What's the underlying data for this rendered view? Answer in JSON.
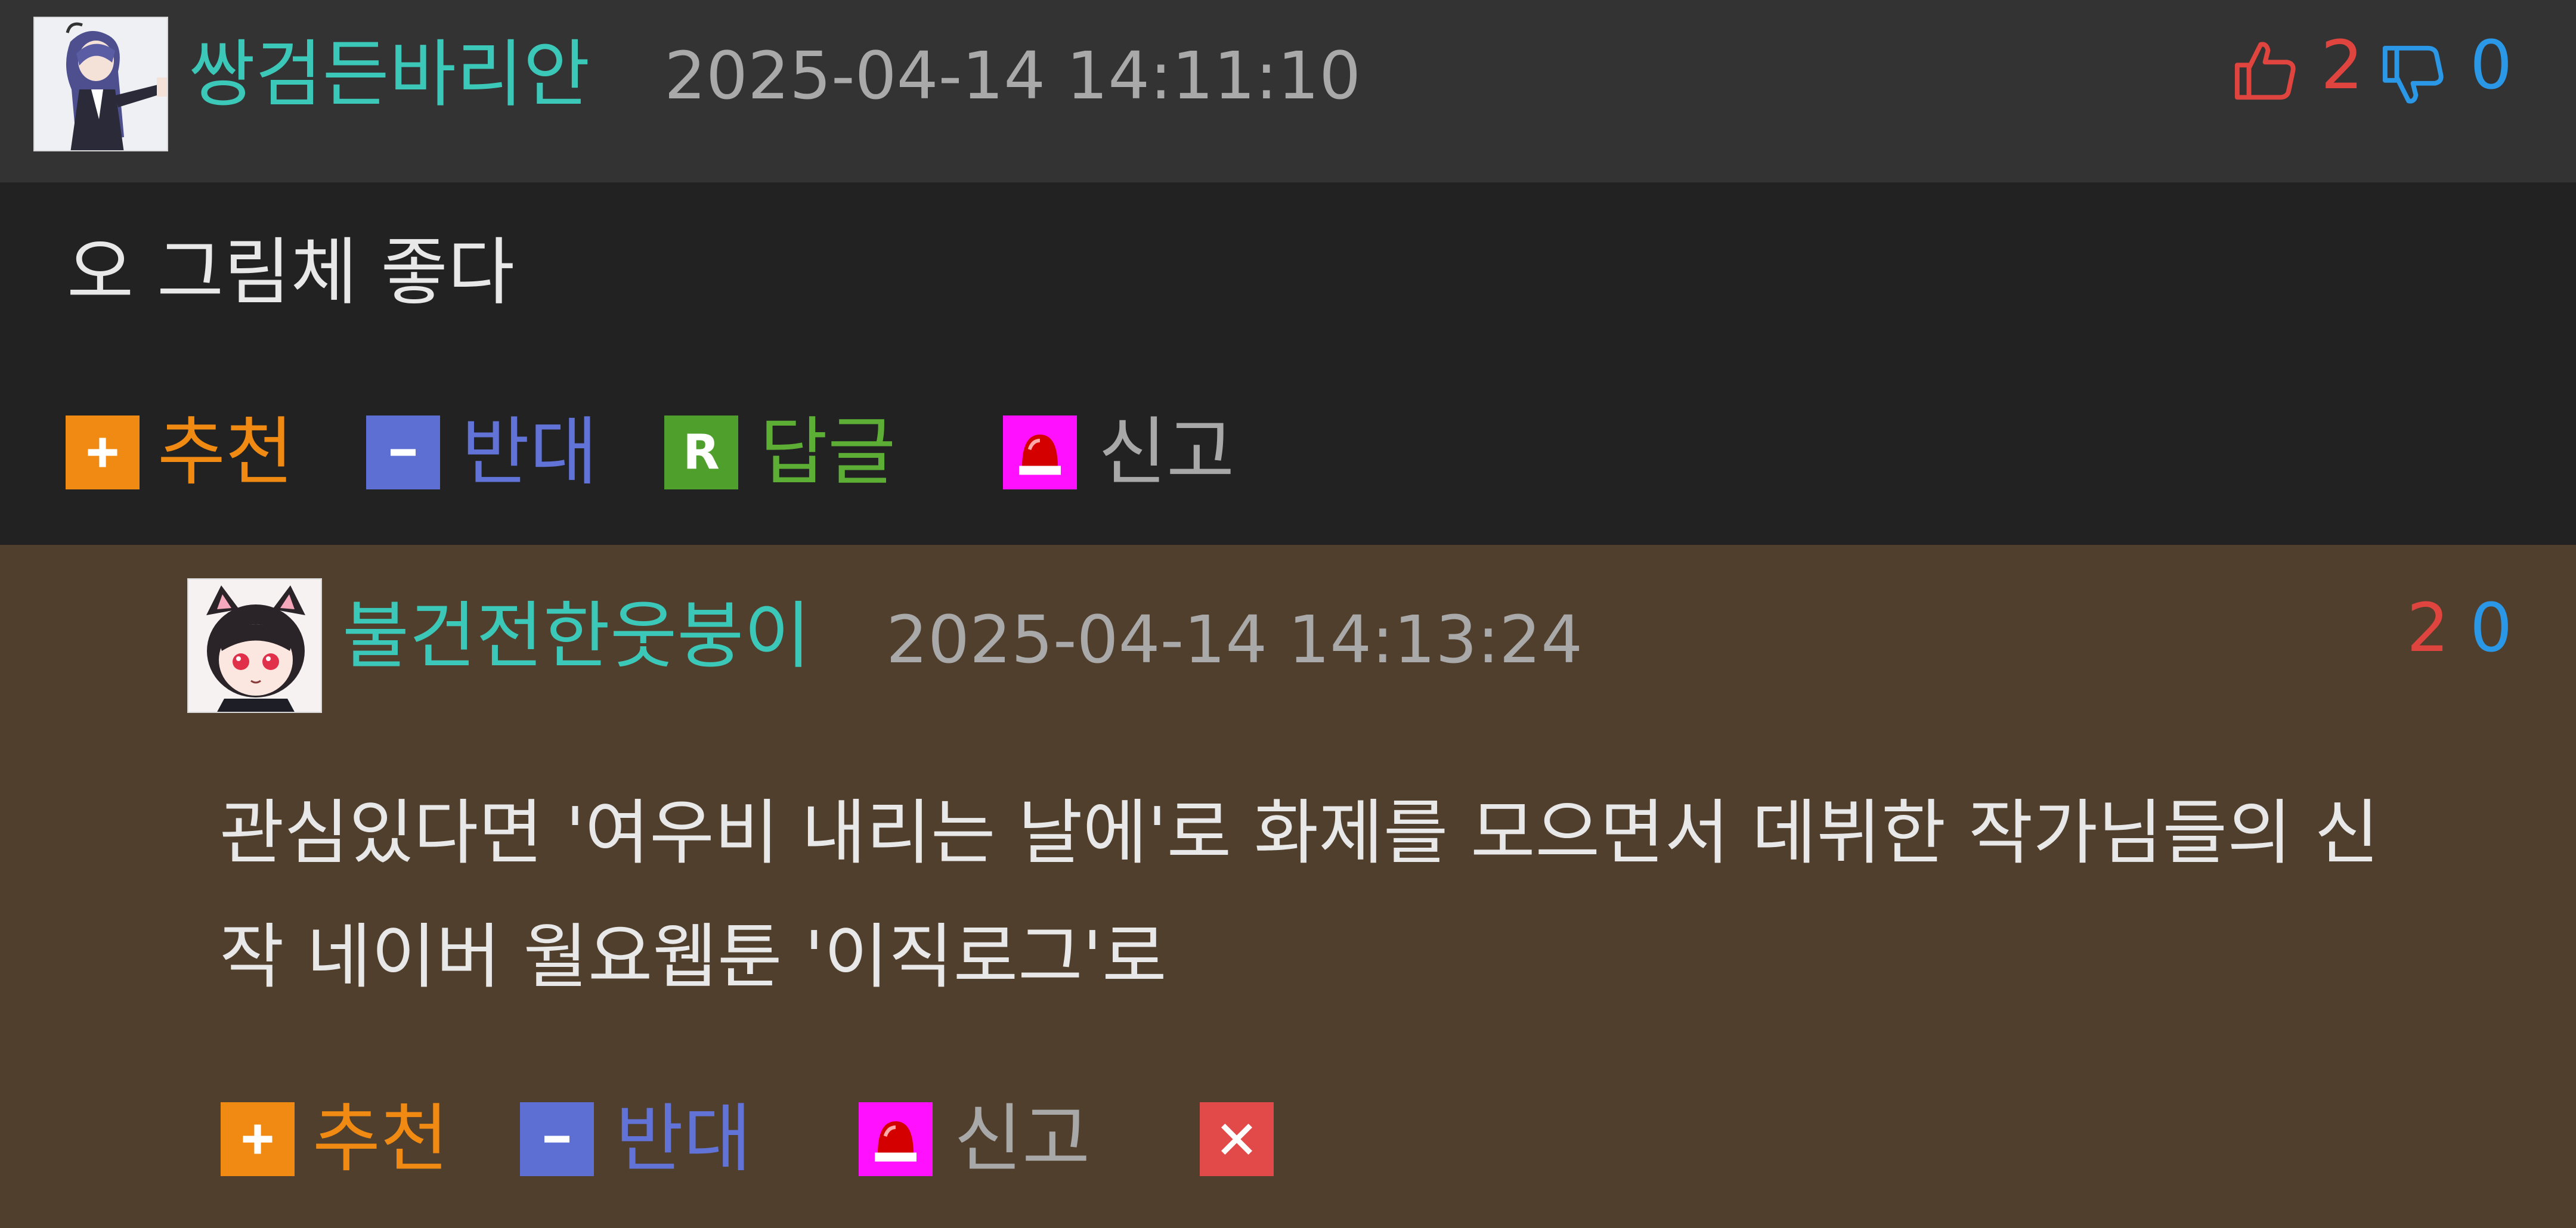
{
  "comments": [
    {
      "author": "쌍검든바리안",
      "timestamp": "2025-04-14 14:11:10",
      "likes": "2",
      "dislikes": "0",
      "body": "오 그림체 좋다",
      "actions": {
        "recommend": "추천",
        "oppose": "반대",
        "reply": "답글",
        "report": "신고"
      },
      "reply_badge": "R"
    },
    {
      "author": "불건전한웃붕이",
      "timestamp": "2025-04-14 14:13:24",
      "likes": "2",
      "dislikes": "0",
      "body_lines": [
        "관심있다면 '여우비 내리는 날에'로 화제를 모으면서 데뷔한 작가님들의 신",
        "작 네이버 월요웹툰 '이직로그'로"
      ],
      "actions": {
        "recommend": "추천",
        "oppose": "반대",
        "report": "신고"
      }
    }
  ],
  "colors": {
    "header_bg": "#333333",
    "comment_bg": "#222222",
    "reply_bg": "#513f2d",
    "nickname": "#3cc8b8",
    "like": "#e0443e",
    "dislike": "#2a98e6",
    "recommend": "#f08a12",
    "oppose": "#5e6fd4",
    "reply": "#4f9f2c",
    "report_icon": "#ff11ff",
    "delete": "#e24a4a"
  },
  "icons": {
    "like": "thumbs-up-icon",
    "dislike": "thumbs-down-icon",
    "recommend": "plus-icon",
    "oppose": "minus-icon",
    "reply": "reply-r-icon",
    "report": "siren-icon",
    "delete": "close-icon"
  }
}
